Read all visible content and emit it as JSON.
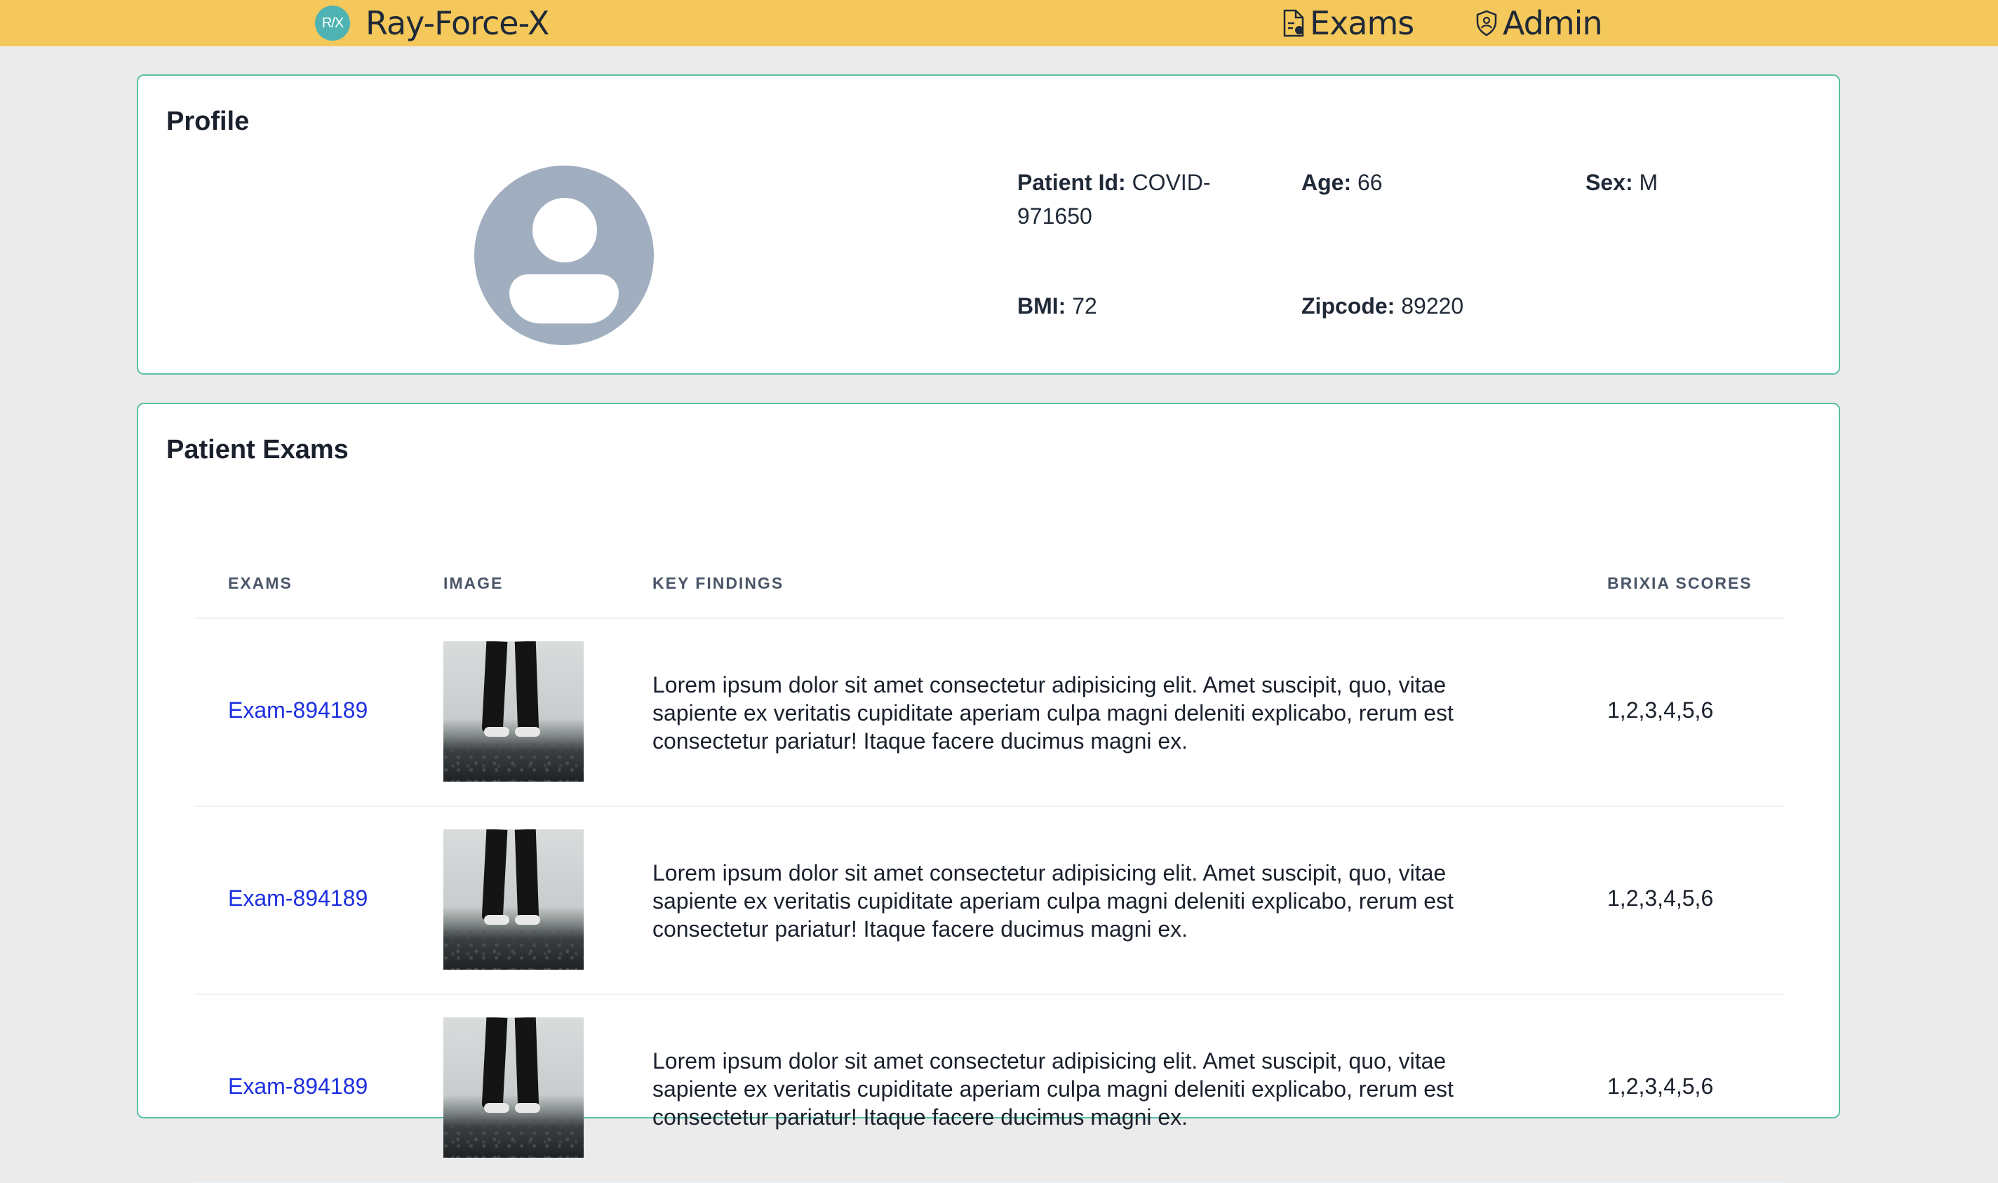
{
  "header": {
    "logo_text": "R/X",
    "brand": "Ray-Force-X",
    "nav": [
      {
        "label": "Exams",
        "icon": "document-icon"
      },
      {
        "label": "Admin",
        "icon": "shield-icon"
      }
    ]
  },
  "profile": {
    "title": "Profile",
    "fields": {
      "patient_id": {
        "label": "Patient Id:",
        "value": "COVID-971650"
      },
      "age": {
        "label": "Age:",
        "value": "66"
      },
      "sex": {
        "label": "Sex:",
        "value": "M"
      },
      "bmi": {
        "label": "BMI:",
        "value": "72"
      },
      "zipcode": {
        "label": "Zipcode:",
        "value": "89220"
      }
    }
  },
  "exams": {
    "title": "Patient Exams",
    "columns": [
      "EXAMS",
      "IMAGE",
      "KEY FINDINGS",
      "BRIXIA SCORES"
    ],
    "rows": [
      {
        "exam": "Exam-894189",
        "findings": "Lorem ipsum dolor sit amet consectetur adipisicing elit. Amet suscipit, quo, vitae sapiente ex veritatis cupiditate aperiam culpa magni deleniti explicabo, rerum est consectetur pariatur! Itaque facere ducimus magni ex.",
        "scores": "1,2,3,4,5,6"
      },
      {
        "exam": "Exam-894189",
        "findings": "Lorem ipsum dolor sit amet consectetur adipisicing elit. Amet suscipit, quo, vitae sapiente ex veritatis cupiditate aperiam culpa magni deleniti explicabo, rerum est consectetur pariatur! Itaque facere ducimus magni ex.",
        "scores": "1,2,3,4,5,6"
      },
      {
        "exam": "Exam-894189",
        "findings": "Lorem ipsum dolor sit amet consectetur adipisicing elit. Amet suscipit, quo, vitae sapiente ex veritatis cupiditate aperiam culpa magni deleniti explicabo, rerum est consectetur pariatur! Itaque facere ducimus magni ex.",
        "scores": "1,2,3,4,5,6"
      }
    ]
  },
  "colors": {
    "header_bg": "#f5c85c",
    "page_bg": "#ebebeb",
    "card_border": "#5bbfa6",
    "link": "#1d2fe0",
    "avatar": "#a0aec0",
    "logo": "#4fb3b3"
  }
}
